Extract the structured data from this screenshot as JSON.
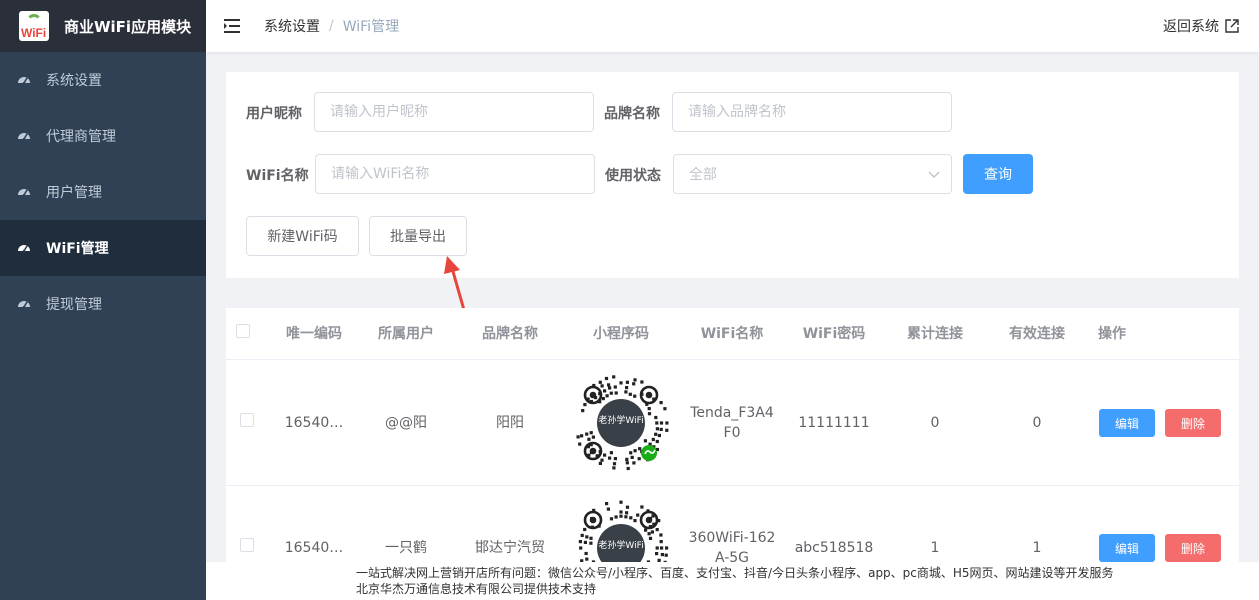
{
  "brand": {
    "title": "商业WiFi应用模块",
    "logo_text": "WiFi"
  },
  "sidebar": {
    "items": [
      {
        "label": "系统设置",
        "icon": "dashboard-icon",
        "active": false
      },
      {
        "label": "代理商管理",
        "icon": "dashboard-icon",
        "active": false
      },
      {
        "label": "用户管理",
        "icon": "dashboard-icon",
        "active": false
      },
      {
        "label": "WiFi管理",
        "icon": "dashboard-icon",
        "active": true
      },
      {
        "label": "提现管理",
        "icon": "dashboard-icon",
        "active": false
      }
    ]
  },
  "header": {
    "breadcrumb": [
      "系统设置",
      "WiFi管理"
    ],
    "separator": "/",
    "back_label": "返回系统"
  },
  "filters": {
    "nickname_label": "用户昵称",
    "nickname_placeholder": "请输入用户昵称",
    "brand_label": "品牌名称",
    "brand_placeholder": "请输入品牌名称",
    "wifi_label": "WiFi名称",
    "wifi_placeholder": "请输入WiFi名称",
    "status_label": "使用状态",
    "status_value": "全部",
    "query_button": "查询",
    "new_button": "新建WiFi码",
    "export_button": "批量导出"
  },
  "table": {
    "columns": [
      "唯一编码",
      "所属用户",
      "品牌名称",
      "小程序码",
      "WiFi名称",
      "WiFi密码",
      "累计连接",
      "有效连接",
      "操作"
    ],
    "edit_label": "编辑",
    "delete_label": "删除",
    "rows": [
      {
        "code": "16540…",
        "user": "@@阳",
        "brand": "阳阳",
        "wifi_line1": "Tenda_F3A4",
        "wifi_line2": "F0",
        "password": "11111111",
        "total": "0",
        "valid": "0",
        "qr_label": "老孙学WiFi"
      },
      {
        "code": "16540…",
        "user": "一只鹤",
        "brand": "邯达宁汽贸",
        "wifi_line1": "360WiFi-162",
        "wifi_line2": "A-5G",
        "password": "abc518518",
        "total": "1",
        "valid": "1",
        "qr_label": "老孙学WiFi"
      }
    ]
  },
  "footer": {
    "line1": "一站式解决网上营销开店所有问题：微信公众号/小程序、百度、支付宝、抖音/今日头条小程序、app、pc商城、H5网页、网站建设等开发服务",
    "line2": "北京华杰万通信息技术有限公司提供技术支持"
  },
  "colors": {
    "sidebar_bg": "#304156",
    "brand_bg": "#2b2f3a",
    "active_bg": "#1f2d3d",
    "primary": "#409eff",
    "danger": "#f56c6c",
    "annotation": "#e8453c"
  }
}
